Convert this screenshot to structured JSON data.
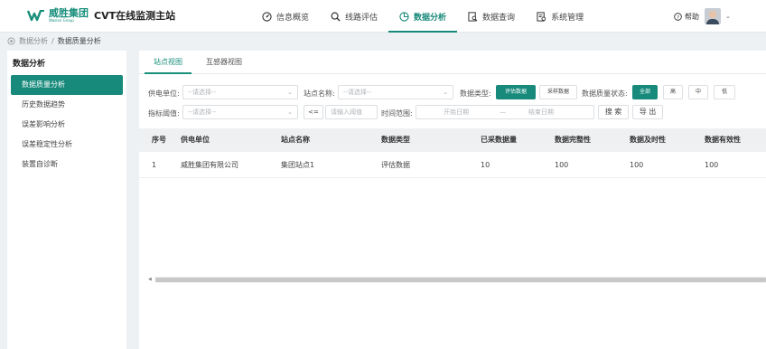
{
  "header": {
    "brand_cn": "威胜集团",
    "brand_en": "Wasion Group",
    "app_title": "CVT在线监测主站",
    "nav": [
      {
        "label": "信息概览",
        "icon": "dashboard-icon"
      },
      {
        "label": "线路评估",
        "icon": "search-icon"
      },
      {
        "label": "数据分析",
        "icon": "pie-chart-icon"
      },
      {
        "label": "数据查询",
        "icon": "document-search-icon"
      },
      {
        "label": "系统管理",
        "icon": "settings-doc-icon"
      }
    ],
    "help_label": "帮助",
    "accent": "#178a7b"
  },
  "breadcrumb": {
    "root": "数据分析",
    "sep": "/",
    "current": "数据质量分析"
  },
  "sidebar": {
    "title": "数据分析",
    "items": [
      {
        "label": "数据质量分析"
      },
      {
        "label": "历史数据趋势"
      },
      {
        "label": "误差影响分析"
      },
      {
        "label": "误差稳定性分析"
      },
      {
        "label": "装置自诊断"
      }
    ]
  },
  "tabs": [
    {
      "label": "站点视图"
    },
    {
      "label": "互感器视图"
    }
  ],
  "filters": {
    "supply_unit_label": "供电单位:",
    "supply_unit_placeholder": "--请选择--",
    "station_name_label": "站点名称:",
    "station_name_placeholder": "--请选择--",
    "data_type_label": "数据类型:",
    "data_type_options": [
      "评估数据",
      "采样数据"
    ],
    "quality_status_label": "数据质量状态:",
    "quality_status_options": [
      "全部",
      "高",
      "中",
      "低"
    ],
    "metric_threshold_label": "指标阈值:",
    "metric_threshold_placeholder": "--请选择--",
    "operator": "<=",
    "threshold_placeholder": "请输入阈值",
    "time_range_label": "时间范围:",
    "start_date_placeholder": "开始日期",
    "date_sep": "—",
    "end_date_placeholder": "结束日期",
    "search_label": "搜 索",
    "export_label": "导 出"
  },
  "table": {
    "columns": [
      "序号",
      "供电单位",
      "站点名称",
      "数据类型",
      "已采数据量",
      "数据完整性",
      "数据及时性",
      "数据有效性"
    ],
    "rows": [
      [
        "1",
        "威胜集团有限公司",
        "集团站点1",
        "评估数据",
        "10",
        "100",
        "100",
        "100"
      ]
    ]
  }
}
